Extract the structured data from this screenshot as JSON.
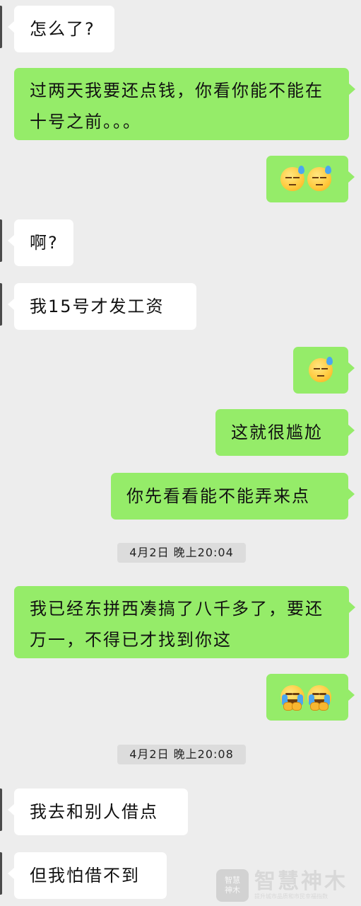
{
  "messages": [
    {
      "text": "怎么了?"
    },
    {
      "text": "过两天我要还点钱，你看你能不能在十号之前。。。"
    },
    {
      "emoji": "sweat-smile-emoji x2"
    },
    {
      "text": "啊?"
    },
    {
      "text": "我15号才发工资"
    },
    {
      "emoji": "sweat-emoji"
    },
    {
      "text": "这就很尴尬"
    },
    {
      "text": "你先看看能不能弄来点"
    },
    {
      "text": "我已经东拼西凑搞了八千多了，要还万一，不得已才找到你这"
    },
    {
      "emoji": "crying-emoji x2"
    },
    {
      "text": "我去和别人借点"
    },
    {
      "text": "但我怕借不到"
    }
  ],
  "timestamps": [
    "4月2日 晚上20:04",
    "4月2日 晚上20:08"
  ],
  "watermark": {
    "logo_line1": "智慧",
    "logo_line2": "神木",
    "title": "智慧神木",
    "subtitle": "提升城市品质和市民幸福指数"
  },
  "colors": {
    "incoming": "#ffffff",
    "outgoing": "#95ec69",
    "background": "#ededed"
  }
}
